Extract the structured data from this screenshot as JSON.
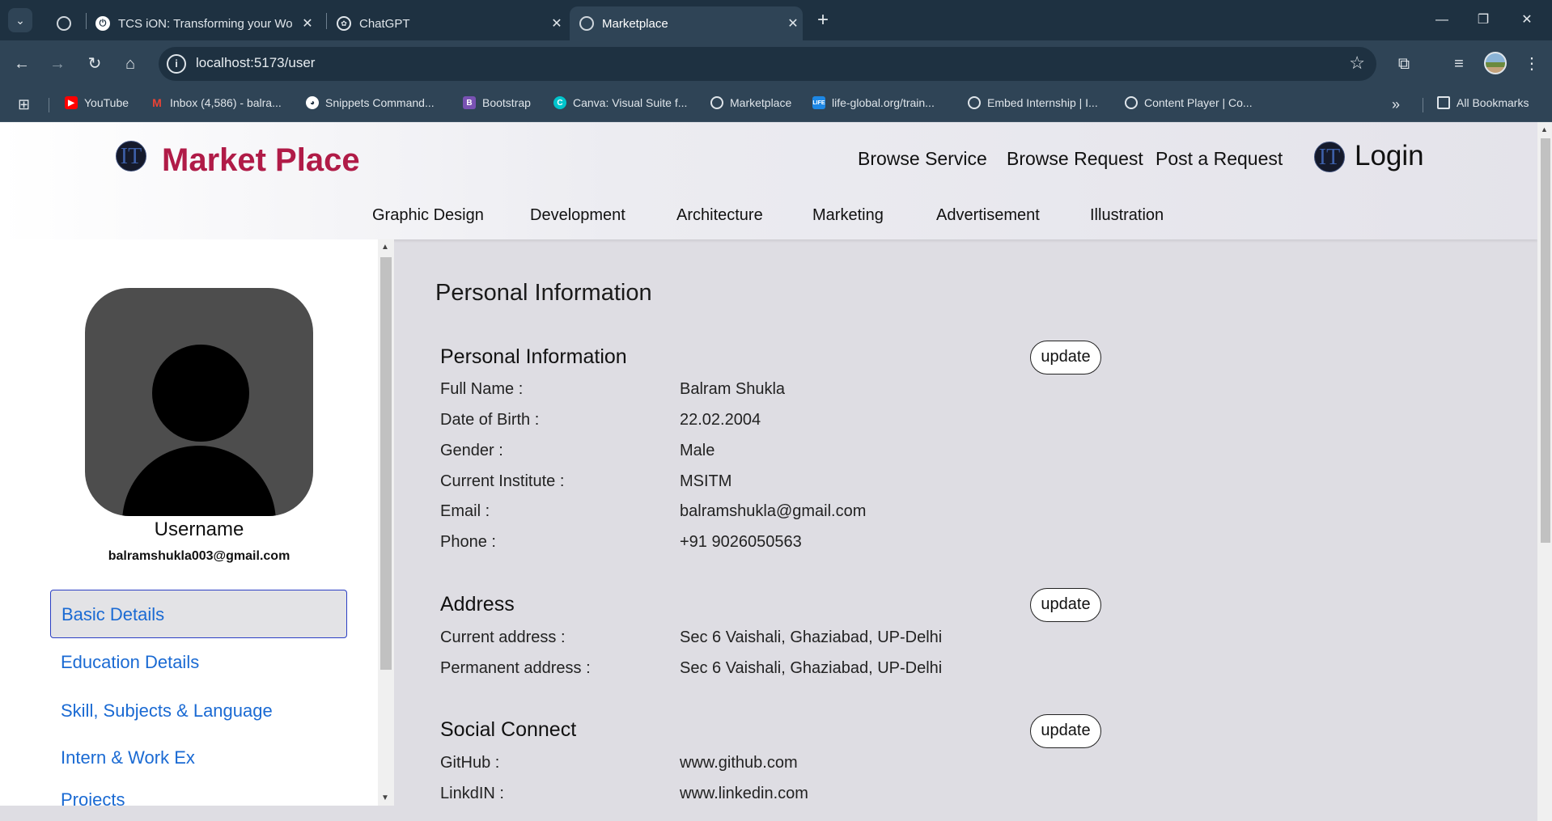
{
  "browser": {
    "tabs": [
      {
        "title": "",
        "icon": "globe-icon"
      },
      {
        "title": "TCS iON: Transforming your Wo",
        "icon": "tcs-ion-icon"
      },
      {
        "title": "ChatGPT",
        "icon": "chatgpt-icon"
      },
      {
        "title": "Marketplace",
        "icon": "globe-icon"
      }
    ],
    "url": "localhost:5173/user",
    "bookmarks": [
      {
        "label": "YouTube",
        "icon": "youtube-icon",
        "color": "#ff0000"
      },
      {
        "label": "Inbox (4,586) - balra...",
        "icon": "gmail-icon",
        "color": "#ea4335"
      },
      {
        "label": "Snippets Command...",
        "icon": "github-icon",
        "color": "#ffffff"
      },
      {
        "label": "Bootstrap",
        "icon": "bootstrap-icon",
        "color": "#7952b3"
      },
      {
        "label": "Canva: Visual Suite f...",
        "icon": "canva-icon",
        "color": "#00c4cc"
      },
      {
        "label": "Marketplace",
        "icon": "globe-icon",
        "color": "#dfe5ea"
      },
      {
        "label": "life-global.org/train...",
        "icon": "life-icon",
        "color": "#1e88e5"
      },
      {
        "label": "Embed Internship | I...",
        "icon": "globe-icon",
        "color": "#dfe5ea"
      },
      {
        "label": "Content Player | Co...",
        "icon": "globe-icon",
        "color": "#dfe5ea"
      }
    ],
    "all_bookmarks": "All Bookmarks"
  },
  "site": {
    "logo_letters": "IT",
    "brand": "Market Place",
    "top_nav": [
      "Browse Service",
      "Browse Request",
      "Post a Request"
    ],
    "login": "Login",
    "categories": [
      "Graphic Design",
      "Development",
      "Architecture",
      "Marketing",
      "Advertisement",
      "Illustration"
    ],
    "brand_color": "#b01b47"
  },
  "sidebar": {
    "username": "Username",
    "email": "balramshukla003@gmail.com",
    "menu": [
      "Basic Details",
      "Education Details",
      "Skill, Subjects & Language",
      "Intern & Work Ex",
      "Projects"
    ],
    "active_index": 0
  },
  "content": {
    "page_title": "Personal Information",
    "update_label": "update",
    "personal": {
      "title": "Personal Information",
      "rows": [
        {
          "label": "Full Name :",
          "value": "Balram Shukla"
        },
        {
          "label": "Date of Birth :",
          "value": "22.02.2004"
        },
        {
          "label": "Gender :",
          "value": "Male"
        },
        {
          "label": "Current Institute :",
          "value": "MSITM"
        },
        {
          "label": "Email :",
          "value": "balramshukla@gmail.com"
        },
        {
          "label": "Phone :",
          "value": "+91 9026050563"
        }
      ]
    },
    "address": {
      "title": "Address",
      "rows": [
        {
          "label": "Current address :",
          "value": "Sec 6 Vaishali, Ghaziabad, UP-Delhi"
        },
        {
          "label": "Permanent address :",
          "value": "Sec 6 Vaishali, Ghaziabad, UP-Delhi"
        }
      ]
    },
    "social": {
      "title": "Social Connect",
      "rows": [
        {
          "label": "GitHub :",
          "value": "www.github.com"
        },
        {
          "label": "LinkdIN :",
          "value": "www.linkedin.com"
        }
      ]
    }
  }
}
